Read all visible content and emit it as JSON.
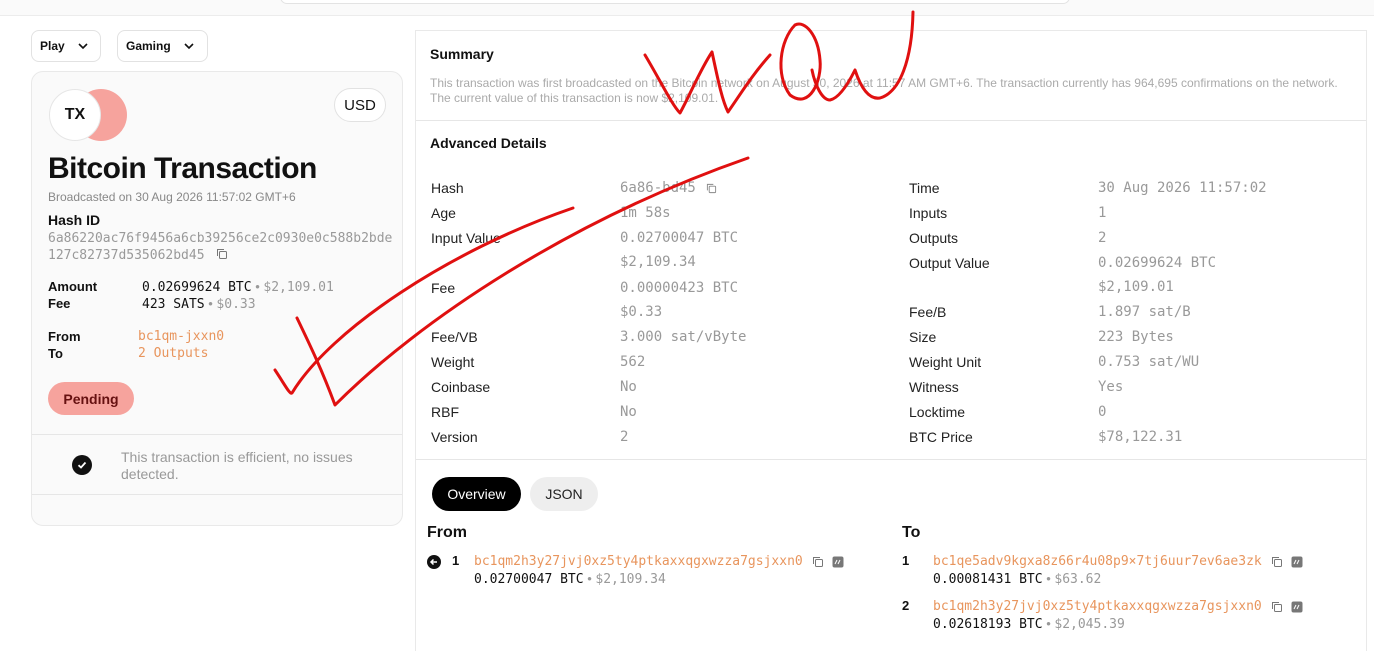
{
  "filters": [
    {
      "label": "Play"
    },
    {
      "label": "Gaming"
    }
  ],
  "card": {
    "icon_text": "TX",
    "currency": "USD",
    "title": "Bitcoin Transaction",
    "broadcast": "Broadcasted on 30 Aug 2026 11:57:02 GMT+6",
    "hash_label": "Hash ID",
    "hash_value": "6a86220ac76f9456a6cb39256ce2c0930e0c588b2bde127c82737d535062bd45",
    "amount_label": "Amount",
    "amount_btc": "0.02699624 BTC",
    "amount_usd": "$2,109.01",
    "fee_label": "Fee",
    "fee_sats": "423 SATS",
    "fee_usd": "$0.33",
    "from_label": "From",
    "from_value": "bc1qm-jxxn0",
    "to_label": "To",
    "to_value": "2 Outputs",
    "status": "Pending",
    "efficiency_msg": "This transaction is efficient, no issues detected."
  },
  "summary": {
    "title": "Summary",
    "text": "This transaction was first broadcasted on the Bitcoin network on August 30, 2026 at 11:57 AM GMT+6. The transaction currently has 964,695 confirmations on the network. The current value of this transaction is now $2,109.01."
  },
  "advanced": {
    "title": "Advanced Details",
    "left": [
      {
        "label": "Hash",
        "value": "6a86-bd45"
      },
      {
        "label": "Age",
        "value": "1m 58s"
      },
      {
        "label": "Input Value",
        "value": "0.02700047 BTC",
        "sub": "$2,109.34"
      },
      {
        "label": "Fee",
        "value": "0.00000423 BTC",
        "sub": "$0.33"
      },
      {
        "label": "Fee/VB",
        "value": "3.000 sat/vByte"
      },
      {
        "label": "Weight",
        "value": "562"
      },
      {
        "label": "Coinbase",
        "value": "No"
      },
      {
        "label": "RBF",
        "value": "No"
      },
      {
        "label": "Version",
        "value": "2"
      }
    ],
    "right": [
      {
        "label": "Time",
        "value": "30 Aug 2026 11:57:02"
      },
      {
        "label": "Inputs",
        "value": "1"
      },
      {
        "label": "Outputs",
        "value": "2"
      },
      {
        "label": "Output Value",
        "value": "0.02699624 BTC",
        "sub": "$2,109.01"
      },
      {
        "label": "Fee/B",
        "value": "1.897 sat/B"
      },
      {
        "label": "Size",
        "value": "223 Bytes"
      },
      {
        "label": "Weight Unit",
        "value": "0.753 sat/WU"
      },
      {
        "label": "Witness",
        "value": "Yes"
      },
      {
        "label": "Locktime",
        "value": "0"
      },
      {
        "label": "BTC Price",
        "value": "$78,122.31"
      }
    ]
  },
  "tabs": [
    {
      "label": "Overview",
      "active": true
    },
    {
      "label": "JSON",
      "active": false
    }
  ],
  "inputs": {
    "title": "From",
    "items": [
      {
        "index": "1",
        "address": "bc1qm2h3y27jvj0xz5ty4ptkaxxqgxwzza7gsjxxn0",
        "btc": "0.02700047 BTC",
        "usd": "$2,109.34"
      }
    ]
  },
  "outputs": {
    "title": "To",
    "items": [
      {
        "index": "1",
        "address": "bc1qe5adv9kgxa8z66r4u08p9×7tj6uur7ev6ae3zk",
        "btc": "0.00081431 BTC",
        "usd": "$63.62"
      },
      {
        "index": "2",
        "address": "bc1qm2h3y27jvj0xz5ty4ptkaxxqgxwzza7gsjxxn0",
        "btc": "0.02618193 BTC",
        "usd": "$2,045.39"
      }
    ]
  },
  "colors": {
    "accent": "#e8955d",
    "pending": "#f6a39d",
    "annotation": "#e01010"
  }
}
